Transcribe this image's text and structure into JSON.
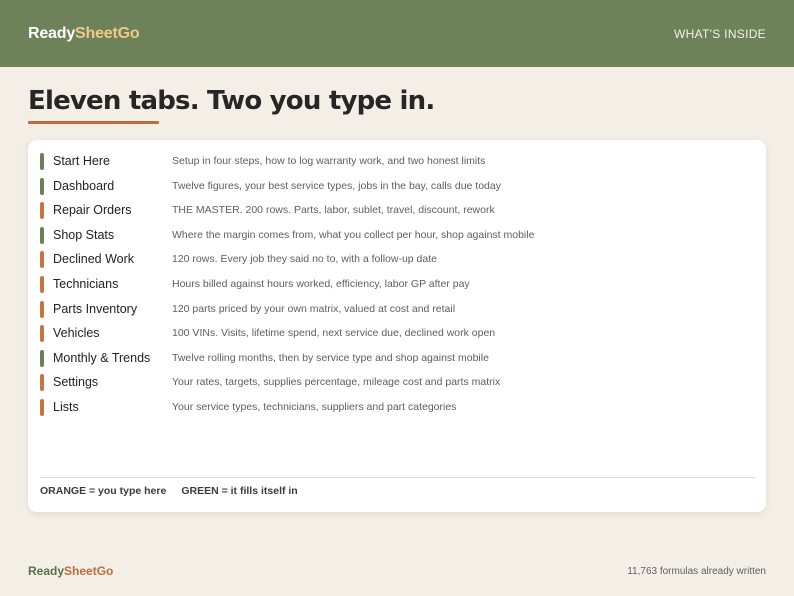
{
  "brand": {
    "part1": "Ready",
    "part2": "SheetGo"
  },
  "header": {
    "nav_label": "WHAT'S INSIDE"
  },
  "title": "Eleven tabs. Two you type in.",
  "colors": {
    "header_bg": "#6e8259",
    "orange": "#c67440",
    "green": "#6a8157",
    "accent": "#c06b3a"
  },
  "tabs": [
    {
      "name": "Start Here",
      "description": "Setup in four steps, how to log warranty work, and two honest limits",
      "type": "green"
    },
    {
      "name": "Dashboard",
      "description": "Twelve figures, your best service types, jobs in the bay, calls due today",
      "type": "green"
    },
    {
      "name": "Repair Orders",
      "description": "THE MASTER. 200 rows. Parts, labor, sublet, travel, discount, rework",
      "type": "orange"
    },
    {
      "name": "Shop Stats",
      "description": "Where the margin comes from, what you collect per hour, shop against mobile",
      "type": "green"
    },
    {
      "name": "Declined Work",
      "description": "120 rows. Every job they said no to, with a follow-up date",
      "type": "orange"
    },
    {
      "name": "Technicians",
      "description": "Hours billed against hours worked, efficiency, labor GP after pay",
      "type": "orange"
    },
    {
      "name": "Parts Inventory",
      "description": "120 parts priced by your own matrix, valued at cost and retail",
      "type": "orange"
    },
    {
      "name": "Vehicles",
      "description": "100 VINs. Visits, lifetime spend, next service due, declined work open",
      "type": "orange"
    },
    {
      "name": "Monthly & Trends",
      "description": "Twelve rolling months, then by service type and shop against mobile",
      "type": "green"
    },
    {
      "name": "Settings",
      "description": "Your rates, targets, supplies percentage, mileage cost and parts matrix",
      "type": "orange"
    },
    {
      "name": "Lists",
      "description": "Your service types, technicians, suppliers and part categories",
      "type": "orange"
    }
  ],
  "legend": {
    "orange": "ORANGE = you type here",
    "green": "GREEN = it fills itself in"
  },
  "footer": {
    "note": "11,763 formulas already written"
  }
}
